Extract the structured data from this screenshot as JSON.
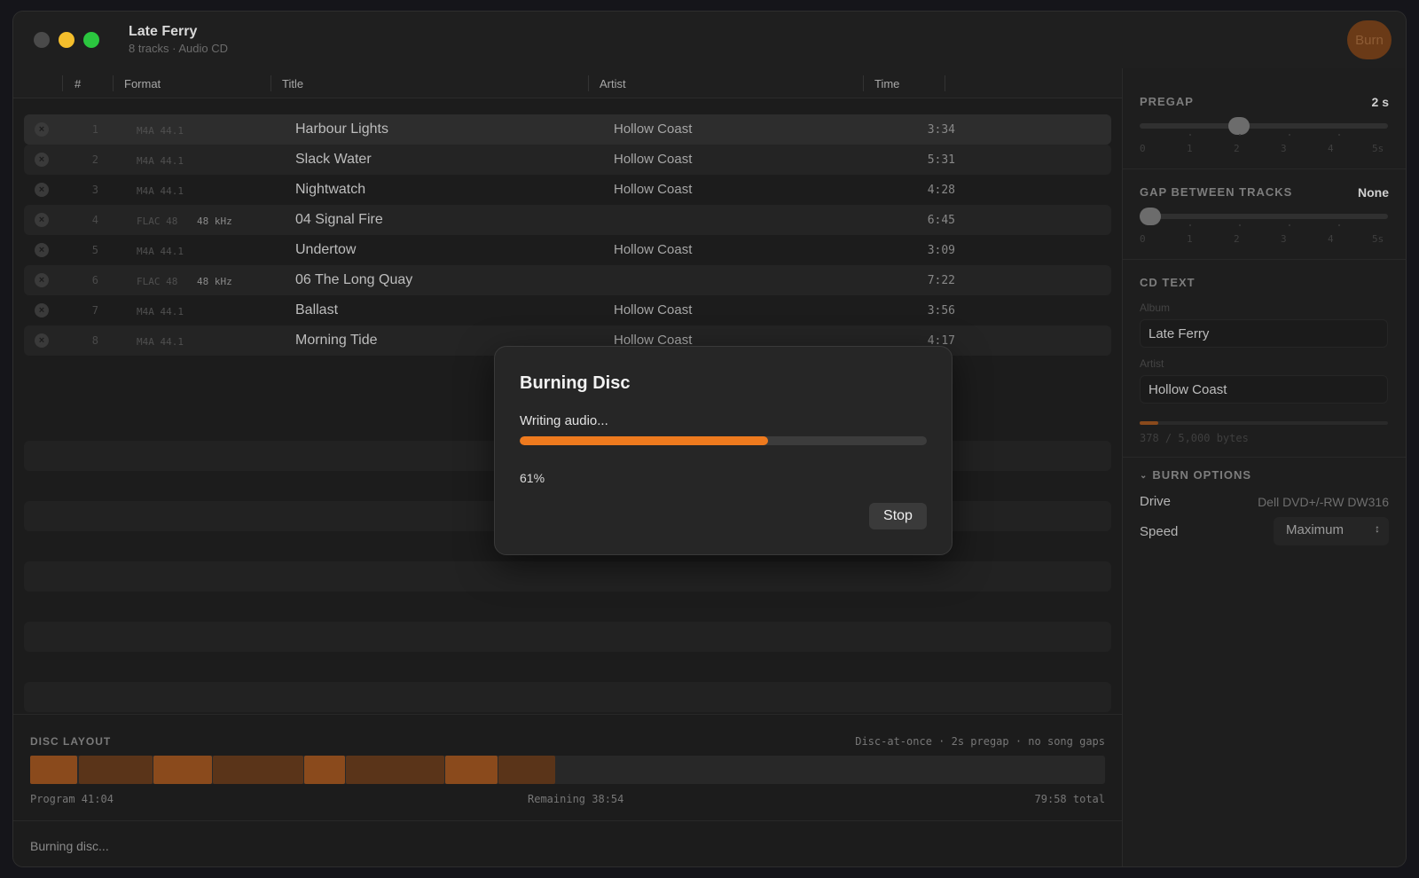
{
  "window": {
    "title": "Late Ferry",
    "subtitle": "8 tracks · Audio CD",
    "burn_label": "Burn"
  },
  "columns": {
    "num": "#",
    "format": "Format",
    "title": "Title",
    "artist": "Artist",
    "time": "Time"
  },
  "tracks": [
    {
      "num": "1",
      "format": "M4A 44.1",
      "rate": "",
      "title": "Harbour Lights",
      "artist": "Hollow Coast",
      "time": "3:34"
    },
    {
      "num": "2",
      "format": "M4A 44.1",
      "rate": "",
      "title": "Slack Water",
      "artist": "Hollow Coast",
      "time": "5:31"
    },
    {
      "num": "3",
      "format": "M4A 44.1",
      "rate": "",
      "title": "Nightwatch",
      "artist": "Hollow Coast",
      "time": "4:28"
    },
    {
      "num": "4",
      "format": "FLAC 48",
      "rate": "48 kHz",
      "title": "04 Signal Fire",
      "artist": "",
      "time": "6:45"
    },
    {
      "num": "5",
      "format": "M4A 44.1",
      "rate": "",
      "title": "Undertow",
      "artist": "Hollow Coast",
      "time": "3:09"
    },
    {
      "num": "6",
      "format": "FLAC 48",
      "rate": "48 kHz",
      "title": "06 The Long Quay",
      "artist": "",
      "time": "7:22"
    },
    {
      "num": "7",
      "format": "M4A 44.1",
      "rate": "",
      "title": "Ballast",
      "artist": "Hollow Coast",
      "time": "3:56"
    },
    {
      "num": "8",
      "format": "M4A 44.1",
      "rate": "",
      "title": "Morning Tide",
      "artist": "Hollow Coast",
      "time": "4:17"
    }
  ],
  "disc": {
    "label": "DISC LAYOUT",
    "mode": "Disc-at-once · 2s pregap · no song gaps",
    "program": "Program 41:04",
    "remaining": "Remaining 38:54",
    "total": "79:58 total",
    "segment_colors": [
      "#8a4a1c",
      "#5a3419"
    ],
    "total_seconds": 4798
  },
  "status": {
    "text": "Burning disc..."
  },
  "inspector": {
    "pregap": {
      "label": "PREGAP",
      "value": "2 s",
      "level": 2,
      "ticks": [
        "0",
        "1",
        "2",
        "3",
        "4",
        "5s"
      ]
    },
    "gap": {
      "label": "GAP BETWEEN TRACKS",
      "value": "None",
      "level": 0,
      "ticks": [
        "0",
        "1",
        "2",
        "3",
        "4",
        "5s"
      ]
    },
    "cdtext": {
      "label": "CD TEXT",
      "album_label": "Album",
      "album_value": "Late Ferry",
      "artist_label": "Artist",
      "artist_value": "Hollow Coast",
      "bytes": "378 / 5,000 bytes",
      "bytes_fraction": 0.0756
    },
    "burn_options": {
      "label": "BURN OPTIONS",
      "drive_label": "Drive",
      "drive_value": "Dell DVD+/-RW DW316",
      "speed_label": "Speed",
      "speed_value": "Maximum"
    }
  },
  "dialog": {
    "title": "Burning Disc",
    "status": "Writing audio...",
    "progress": 0.61,
    "percent_label": "61%",
    "stop_label": "Stop"
  },
  "colors": {
    "accent": "#ee7a1e",
    "burn_button": "#6a3a17"
  }
}
